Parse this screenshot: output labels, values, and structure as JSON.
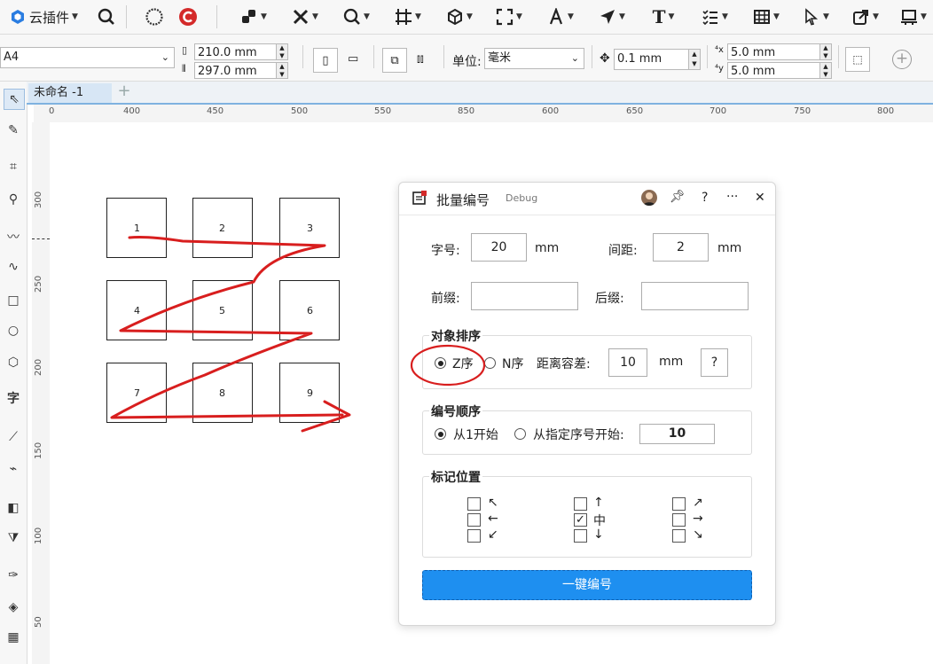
{
  "app": {
    "plugin_menu": "云插件"
  },
  "toolbar1": {
    "icons": [
      "search-icon",
      "circle-icon",
      "c-logo-icon",
      "transform-icon",
      "cross-icon",
      "zoom-icon",
      "grid-icon",
      "cube-icon",
      "expand-icon",
      "a-icon",
      "send-icon",
      "text-icon",
      "list-icon",
      "table-icon",
      "pointer-icon",
      "square-arrow-icon",
      "frame-icon"
    ]
  },
  "property_bar": {
    "page_size": "A4",
    "width": "210.0 mm",
    "height": "297.0 mm",
    "units_label": "单位:",
    "units_value": "毫米",
    "nudge": "0.1 mm",
    "dup_x": "5.0 mm",
    "dup_y": "5.0 mm"
  },
  "document_tab": {
    "label": "未命名 -1",
    "add": "+"
  },
  "ruler": {
    "h_labels": [
      "0",
      "400",
      "450",
      "500",
      "550",
      "600",
      "650",
      "700",
      "750",
      "800",
      "850"
    ],
    "v_labels": [
      "300",
      "250",
      "200",
      "150",
      "100",
      "50"
    ]
  },
  "canvas": {
    "boxes": [
      "1",
      "2",
      "3",
      "4",
      "5",
      "6",
      "7",
      "8",
      "9"
    ],
    "annotation_color": "#d81e1e"
  },
  "dialog": {
    "title": "批量编号",
    "debug": "Debug",
    "help": "?",
    "more": "···",
    "close": "✕",
    "font_size_label": "字号:",
    "font_size_value": "20",
    "font_size_unit": "mm",
    "spacing_label": "间距:",
    "spacing_value": "2",
    "spacing_unit": "mm",
    "prefix_label": "前缀:",
    "prefix_value": "",
    "suffix_label": "后缀:",
    "suffix_value": "",
    "sort_title": "对象排序",
    "z_order": "Z序",
    "n_order": "N序",
    "tolerance_label": "距离容差:",
    "tolerance_value": "10",
    "tolerance_unit": "mm",
    "tolerance_help": "?",
    "order_title": "编号顺序",
    "from_one": "从1开始",
    "from_given": "从指定序号开始:",
    "start_value": "10",
    "mark_title": "标记位置",
    "mark_center": "中",
    "run_button": "一键编号"
  }
}
